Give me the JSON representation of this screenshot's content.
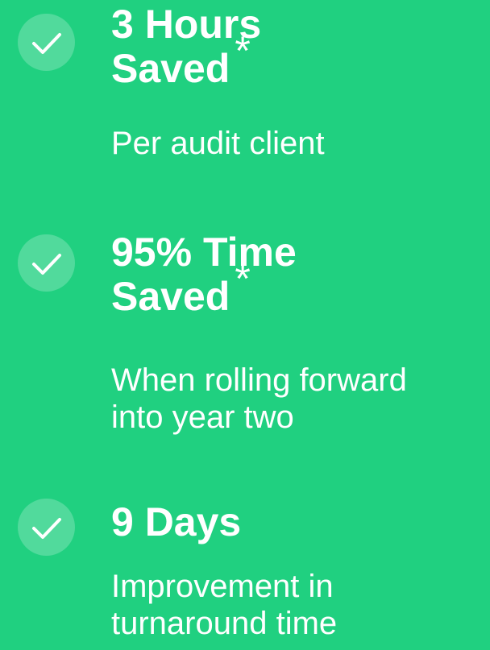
{
  "theme": {
    "background": "#20d080",
    "text": "#ffffff"
  },
  "stats": [
    {
      "icon": "check-icon",
      "headline": [
        "3 Hours",
        "Saved"
      ],
      "asterisk": "*",
      "subtext": [
        "Per audit client"
      ]
    },
    {
      "icon": "check-icon",
      "headline": [
        "95% Time",
        "Saved"
      ],
      "asterisk": "*",
      "subtext": [
        "When rolling forward",
        "into year two"
      ]
    },
    {
      "icon": "check-icon",
      "headline": [
        "9 Days"
      ],
      "subtext": [
        "Improvement in",
        "turnaround time"
      ]
    }
  ]
}
